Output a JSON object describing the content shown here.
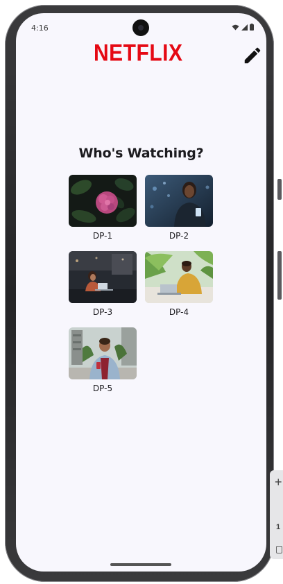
{
  "status_bar": {
    "time": "4:16",
    "icons": [
      "wifi-icon",
      "signal-icon",
      "battery-icon"
    ]
  },
  "header": {
    "logo_text": "NETFLIX",
    "logo_color": "#e50914",
    "edit_icon": "pencil-icon"
  },
  "title": "Who's Watching?",
  "profiles": [
    {
      "name": "DP-1",
      "image": "pink flower on dark leaves"
    },
    {
      "name": "DP-2",
      "image": "person with phone at night in city"
    },
    {
      "name": "DP-3",
      "image": "woman at laptop in dark office"
    },
    {
      "name": "DP-4",
      "image": "man with laptop under palm trees"
    },
    {
      "name": "DP-5",
      "image": "smiling man with phone on street"
    }
  ],
  "colors": {
    "background": "#f8f7fd",
    "text": "#1c1b1f"
  }
}
